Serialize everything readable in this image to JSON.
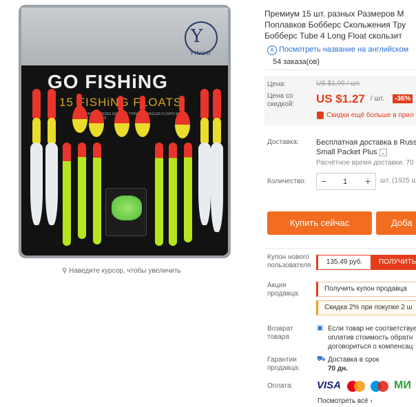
{
  "product_image": {
    "brand": "YINUO",
    "headline": "GO FISHiNG",
    "subheadline": "15 FISHiNG FLOATS",
    "fine_print": "CONTAINS 15 SIZES OF MOST TYPES OF ANGLER FLOATS WITH FLOAT RUBBERS"
  },
  "zoom_hint": "Наведите курсор, чтобы увеличить",
  "title": "Премиум 15 шт. разных Размеров Многоцветных Поплавков Бобберс Скольжения Труба Бобберс Tube 4 Long Float скользит",
  "title_lines": [
    "Премиум 15 шт. разных Размеров М",
    "Поплавков Бобберс Скольжения Тру",
    "Бобберс Tube 4 Long Float скользит"
  ],
  "translate_link": "Посмотреть название на английском",
  "orders": "54 заказа(ов)",
  "price": {
    "label": "Цена:",
    "old": "US $1,99 / шт.",
    "discount_label": "Цена со скидкой:",
    "current": "US $1.27",
    "unit": "/ шт.",
    "badge": "-36%",
    "more_discounts": "Скидки ещё больше в прил"
  },
  "shipping": {
    "label": "Доставка:",
    "line1": "Бесплатная доставка в Russi",
    "line2": "Small Packet Plus",
    "estimated": "Расчётное время доставки: 70"
  },
  "quantity": {
    "label": "Количество:",
    "value": "1",
    "stock": "шт. (1925 ш"
  },
  "buttons": {
    "buy_now": "Купить сейчас",
    "add_to_cart": "Доба"
  },
  "coupon": {
    "label": "Купон нового пользователя",
    "value": "135,49 руб.",
    "button": "ПОЛУЧИТЬ"
  },
  "seller_promo": {
    "label": "Акция продавца:",
    "get_coupon": "Получить купон продавца",
    "discount": "Скидка 2% при покупке 2 ш"
  },
  "returns": {
    "label": "Возврат товара",
    "line1": "Если товар не соответствует",
    "line2": "оплатив стоимость обратн",
    "line3": "договориться о компенсац"
  },
  "guarantee": {
    "label": "Гарантии продавца:",
    "line1": "Доставка в срок",
    "line2": "70 дн."
  },
  "payment": {
    "label": "Оплата:",
    "visa": "VISA",
    "mir": "МИ",
    "see_all": "Посмотреть всё"
  },
  "colors": {
    "accent": "#f36d20",
    "price_red": "#e43d1b",
    "link_blue": "#2e6fd1"
  }
}
